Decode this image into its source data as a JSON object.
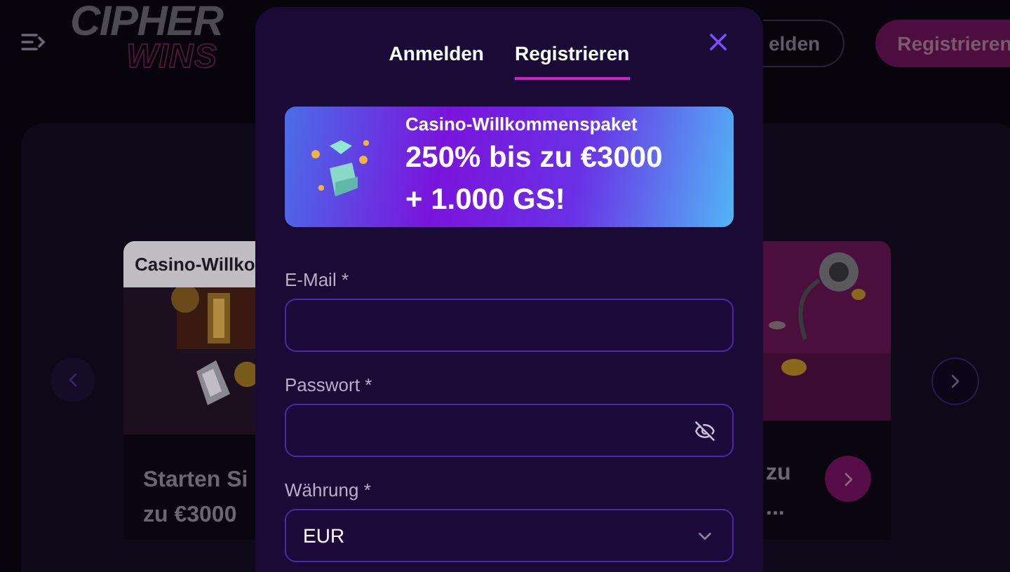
{
  "background": {
    "logo": {
      "line_1": "CIPHER",
      "line_2": "WINS"
    },
    "header_buttons": [
      {
        "kind": "outline",
        "label": "elden"
      },
      {
        "kind": "filled",
        "label": "Registrieren"
      }
    ],
    "left_card": {
      "tag": "Casino-Willko",
      "title_lines": [
        "Starten Si",
        "zu €3000"
      ]
    },
    "right_card": {
      "title_lines": [
        "zu",
        "..."
      ]
    }
  },
  "dialog": {
    "tabs": [
      {
        "label": "Anmelden",
        "selected": false
      },
      {
        "label": "Registrieren",
        "selected": true
      }
    ],
    "banner": {
      "subtitle": "Casino-Willkommenspaket",
      "headline_lines": [
        "250% bis zu €3000",
        "+ 1.000 GS!"
      ]
    },
    "fields": [
      {
        "kind": "text",
        "label": "E-Mail *"
      },
      {
        "kind": "password",
        "label": "Passwort *"
      },
      {
        "kind": "select",
        "label": "Währung *",
        "value": "EUR"
      }
    ]
  }
}
